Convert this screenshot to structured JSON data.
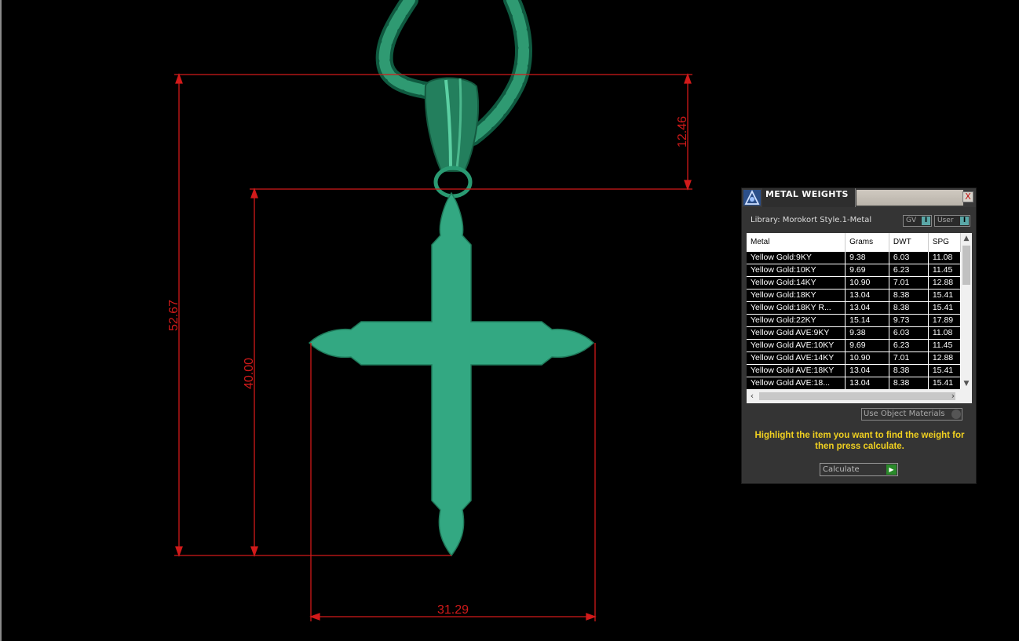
{
  "viewport": {
    "dimensions": {
      "total_height": "52.67",
      "cross_height": "40.00",
      "bail_height": "12.46",
      "cross_width": "31.29"
    },
    "colors": {
      "dimension": "#d21a1a",
      "model": "#33a882",
      "model_dark": "#1f7a5a"
    }
  },
  "panel": {
    "title": "METAL WEIGHTS",
    "close_label": "X",
    "library_label": "Library: Morokort Style.1-Metal",
    "gv_label": "GV",
    "user_label": "User",
    "toggle_glyph": "I",
    "table": {
      "headers": [
        "Metal",
        "Grams",
        "DWT",
        "SPG"
      ],
      "rows": [
        [
          "Yellow Gold:9KY",
          "9.38",
          "6.03",
          "11.08"
        ],
        [
          "Yellow Gold:10KY",
          "9.69",
          "6.23",
          "11.45"
        ],
        [
          "Yellow Gold:14KY",
          "10.90",
          "7.01",
          "12.88"
        ],
        [
          "Yellow Gold:18KY",
          "13.04",
          "8.38",
          "15.41"
        ],
        [
          "Yellow Gold:18KY R...",
          "13.04",
          "8.38",
          "15.41"
        ],
        [
          "Yellow Gold:22KY",
          "15.14",
          "9.73",
          "17.89"
        ],
        [
          "Yellow Gold AVE:9KY",
          "9.38",
          "6.03",
          "11.08"
        ],
        [
          "Yellow Gold AVE:10KY",
          "9.69",
          "6.23",
          "11.45"
        ],
        [
          "Yellow Gold AVE:14KY",
          "10.90",
          "7.01",
          "12.88"
        ],
        [
          "Yellow Gold AVE:18KY",
          "13.04",
          "8.38",
          "15.41"
        ],
        [
          "Yellow Gold AVE:18...",
          "13.04",
          "8.38",
          "15.41"
        ]
      ]
    },
    "use_object_materials": "Use Object Materials",
    "hint": "Highlight the item you want to find the weight for then press calculate.",
    "calculate_label": "Calculate",
    "accent": "#f0d020"
  }
}
